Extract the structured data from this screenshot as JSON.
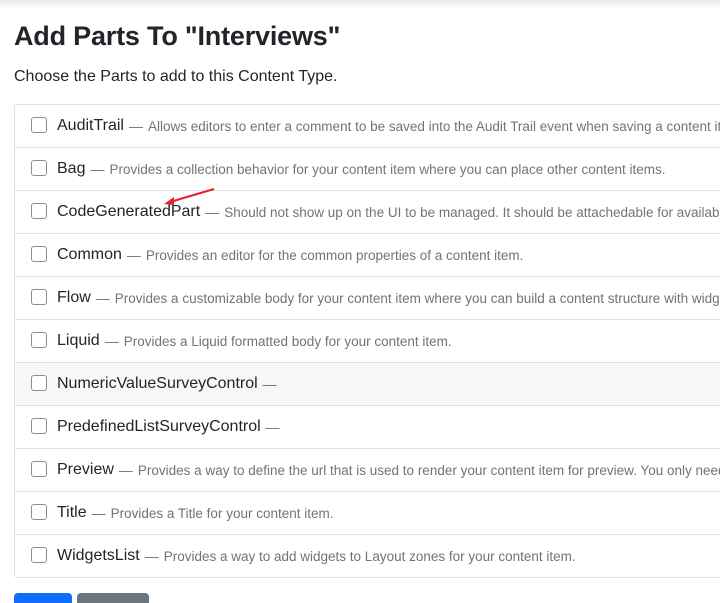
{
  "page": {
    "title": "Add Parts To \"Interviews\"",
    "subtitle": "Choose the Parts to add to this Content Type."
  },
  "separator": "—",
  "parts": [
    {
      "name": "AuditTrail",
      "description": "Allows editors to enter a comment to be saved into the Audit Trail event when saving a content item."
    },
    {
      "name": "Bag",
      "description": "Provides a collection behavior for your content item where you can place other content items."
    },
    {
      "name": "CodeGeneratedPart",
      "description": "Should not show up on the UI to be managed. It should be attachedable for available types."
    },
    {
      "name": "Common",
      "description": "Provides an editor for the common properties of a content item."
    },
    {
      "name": "Flow",
      "description": "Provides a customizable body for your content item where you can build a content structure with widgets."
    },
    {
      "name": "Liquid",
      "description": "Provides a Liquid formatted body for your content item."
    },
    {
      "name": "NumericValueSurveyControl",
      "description": ""
    },
    {
      "name": "PredefinedListSurveyControl",
      "description": ""
    },
    {
      "name": "Preview",
      "description": "Provides a way to define the url that is used to render your content item for preview. You only need this."
    },
    {
      "name": "Title",
      "description": "Provides a Title for your content item."
    },
    {
      "name": "WidgetsList",
      "description": "Provides a way to add widgets to Layout zones for your content item."
    }
  ],
  "annotation": {
    "color": "#e8202a"
  },
  "colors": {
    "primary": "#0d6efd",
    "secondary": "#6c757d"
  }
}
